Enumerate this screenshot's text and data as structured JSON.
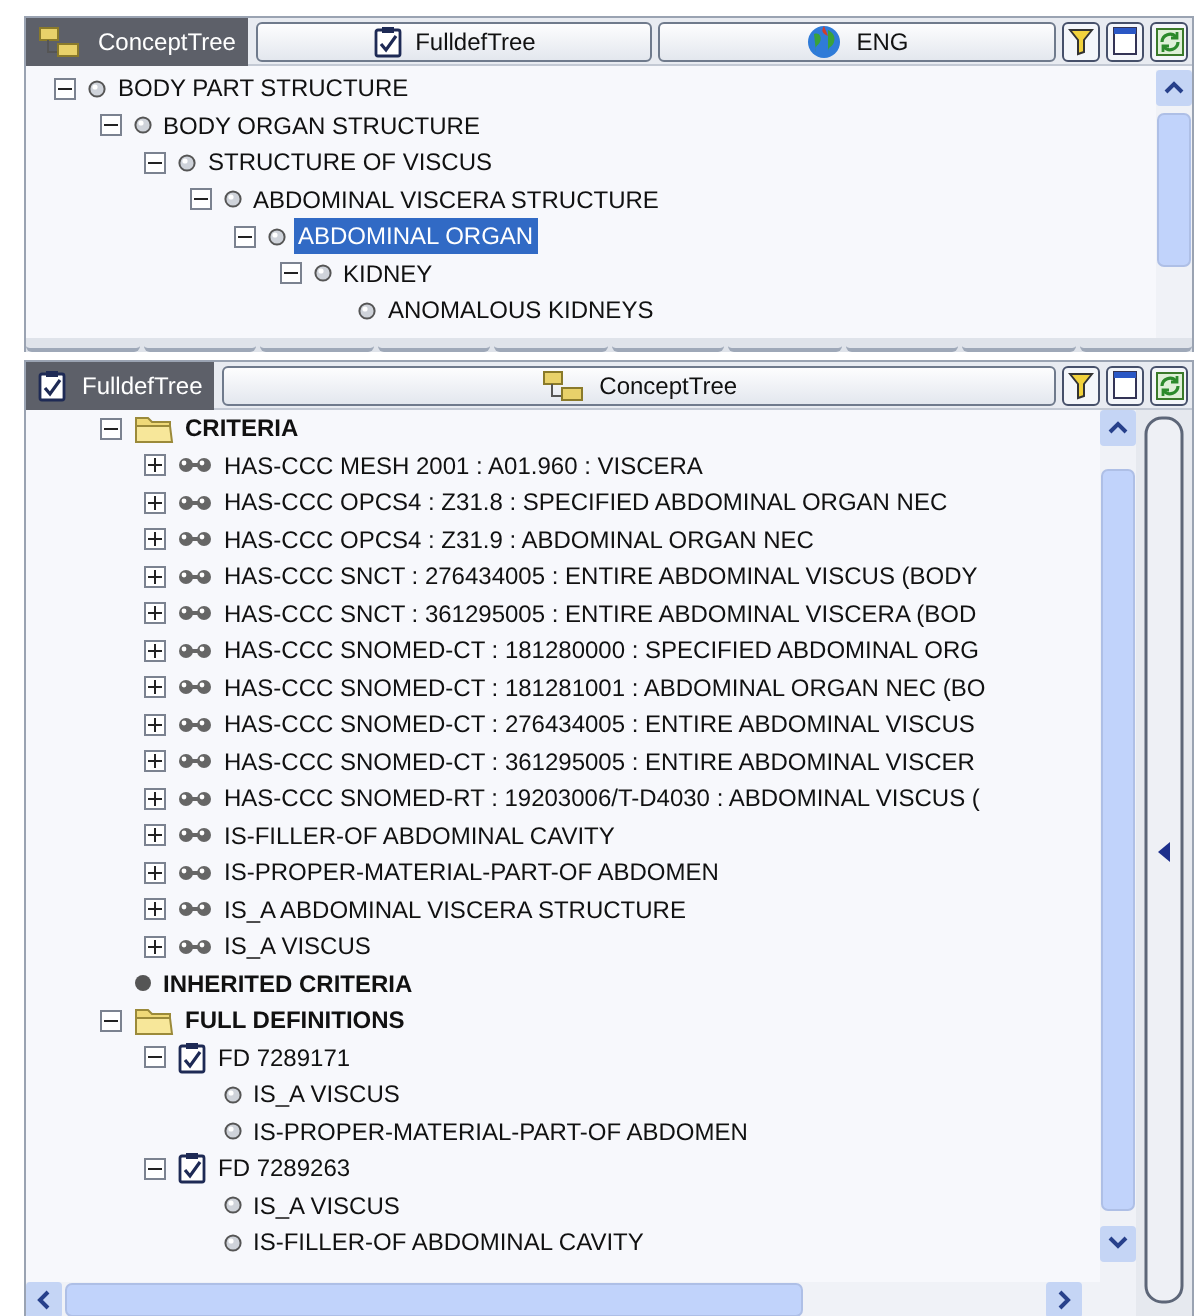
{
  "concept_panel": {
    "tabs": [
      {
        "label": "ConceptTree",
        "kind": "tree",
        "selected": true
      },
      {
        "label": "FulldefTree",
        "kind": "fulldef",
        "selected": false
      },
      {
        "label": "ENG",
        "kind": "globe",
        "selected": false
      }
    ],
    "tree": [
      {
        "label": "BODY PART STRUCTURE",
        "kind": "concept",
        "expanded": true,
        "selected": false,
        "children": [
          {
            "label": "BODY ORGAN STRUCTURE",
            "kind": "concept",
            "expanded": true,
            "selected": false,
            "children": [
              {
                "label": "STRUCTURE OF VISCUS",
                "kind": "concept",
                "expanded": true,
                "selected": false,
                "children": [
                  {
                    "label": "ABDOMINAL VISCERA STRUCTURE",
                    "kind": "concept",
                    "expanded": true,
                    "selected": false,
                    "children": [
                      {
                        "label": "ABDOMINAL ORGAN",
                        "kind": "concept",
                        "expanded": true,
                        "selected": true,
                        "children": [
                          {
                            "label": "KIDNEY",
                            "kind": "concept",
                            "expanded": true,
                            "selected": false,
                            "children": [
                              {
                                "label": "ANOMALOUS KIDNEYS",
                                "kind": "concept",
                                "selected": false
                              }
                            ]
                          }
                        ]
                      }
                    ]
                  }
                ]
              }
            ]
          }
        ]
      }
    ]
  },
  "fulldef_panel": {
    "tabs": [
      {
        "label": "FulldefTree",
        "kind": "fulldef",
        "selected": true
      },
      {
        "label": "ConceptTree",
        "kind": "tree",
        "selected": false
      }
    ],
    "tree": [
      {
        "label": "CRITERIA",
        "kind": "folder",
        "expanded": true,
        "selected": false,
        "children": [
          {
            "label": "HAS-CCC MESH 2001 : A01.960 : VISCERA",
            "kind": "relation",
            "expanded": false,
            "selected": false
          },
          {
            "label": "HAS-CCC OPCS4 : Z31.8 : SPECIFIED ABDOMINAL ORGAN NEC",
            "kind": "relation",
            "expanded": false,
            "selected": false
          },
          {
            "label": "HAS-CCC OPCS4 : Z31.9 : ABDOMINAL ORGAN NEC",
            "kind": "relation",
            "expanded": false,
            "selected": false
          },
          {
            "label": "HAS-CCC SNCT : 276434005 : ENTIRE ABDOMINAL VISCUS (BODY",
            "kind": "relation",
            "expanded": false,
            "selected": false
          },
          {
            "label": "HAS-CCC SNCT : 361295005 : ENTIRE ABDOMINAL VISCERA (BOD",
            "kind": "relation",
            "expanded": false,
            "selected": false
          },
          {
            "label": "HAS-CCC SNOMED-CT : 181280000 : SPECIFIED ABDOMINAL ORG",
            "kind": "relation",
            "expanded": false,
            "selected": false
          },
          {
            "label": "HAS-CCC SNOMED-CT : 181281001 : ABDOMINAL ORGAN NEC (BO",
            "kind": "relation",
            "expanded": false,
            "selected": false
          },
          {
            "label": "HAS-CCC SNOMED-CT : 276434005 : ENTIRE ABDOMINAL VISCUS",
            "kind": "relation",
            "expanded": false,
            "selected": false
          },
          {
            "label": "HAS-CCC SNOMED-CT : 361295005 : ENTIRE ABDOMINAL VISCER",
            "kind": "relation",
            "expanded": false,
            "selected": false
          },
          {
            "label": "HAS-CCC SNOMED-RT : 19203006/T-D4030 : ABDOMINAL VISCUS (",
            "kind": "relation",
            "expanded": false,
            "selected": false
          },
          {
            "label": "IS-FILLER-OF ABDOMINAL CAVITY",
            "kind": "relation",
            "expanded": false,
            "selected": false
          },
          {
            "label": "IS-PROPER-MATERIAL-PART-OF ABDOMEN",
            "kind": "relation",
            "expanded": false,
            "selected": false
          },
          {
            "label": "IS_A ABDOMINAL VISCERA STRUCTURE",
            "kind": "relation",
            "expanded": false,
            "selected": false
          },
          {
            "label": "IS_A VISCUS",
            "kind": "relation",
            "expanded": false,
            "selected": false
          }
        ]
      },
      {
        "label": "INHERITED CRITERIA",
        "kind": "inherited",
        "selected": false
      },
      {
        "label": "FULL DEFINITIONS",
        "kind": "folder",
        "expanded": true,
        "selected": false,
        "children": [
          {
            "label": "FD 7289171",
            "kind": "fulldef",
            "expanded": true,
            "selected": false,
            "children": [
              {
                "label": "IS_A VISCUS",
                "kind": "concept",
                "selected": false
              },
              {
                "label": "IS-PROPER-MATERIAL-PART-OF ABDOMEN",
                "kind": "concept",
                "selected": false
              }
            ]
          },
          {
            "label": "FD 7289263",
            "kind": "fulldef",
            "expanded": true,
            "selected": false,
            "children": [
              {
                "label": "IS_A VISCUS",
                "kind": "concept",
                "selected": false
              },
              {
                "label": "IS-FILLER-OF ABDOMINAL CAVITY",
                "kind": "concept",
                "selected": false
              }
            ]
          }
        ]
      }
    ]
  }
}
